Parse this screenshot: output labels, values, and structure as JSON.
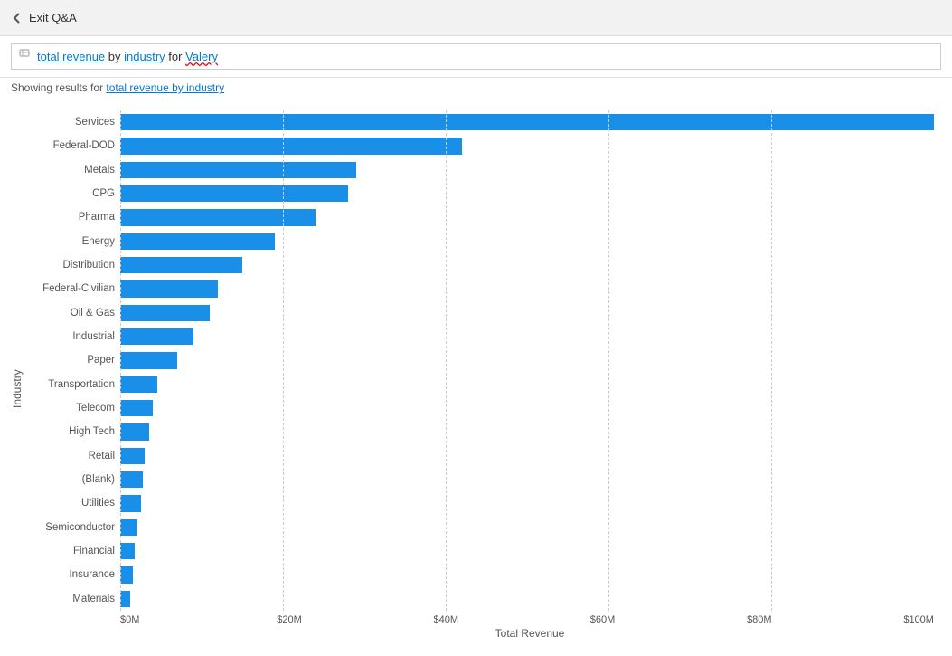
{
  "header": {
    "back_label": "Exit Q&A"
  },
  "search": {
    "query_parts": [
      {
        "text": "total revenue",
        "style": "underline-blue"
      },
      {
        "text": " by ",
        "style": "plain"
      },
      {
        "text": "industry",
        "style": "underline-blue"
      },
      {
        "text": " for ",
        "style": "plain"
      },
      {
        "text": "Valery",
        "style": "underline-red"
      }
    ]
  },
  "results_info": "Showing results for ",
  "results_link": "total revenue by industry",
  "y_axis_label": "Industry",
  "x_axis_label": "Total Revenue",
  "x_ticks": [
    "$0M",
    "$20M",
    "$40M",
    "$60M",
    "$80M",
    "$100M"
  ],
  "bars": [
    {
      "label": "Services",
      "value": 100
    },
    {
      "label": "Federal-DOD",
      "value": 42
    },
    {
      "label": "Metals",
      "value": 29
    },
    {
      "label": "CPG",
      "value": 28
    },
    {
      "label": "Pharma",
      "value": 24
    },
    {
      "label": "Energy",
      "value": 19
    },
    {
      "label": "Distribution",
      "value": 15
    },
    {
      "label": "Federal-Civilian",
      "value": 12
    },
    {
      "label": "Oil & Gas",
      "value": 11
    },
    {
      "label": "Industrial",
      "value": 9
    },
    {
      "label": "Paper",
      "value": 7
    },
    {
      "label": "Transportation",
      "value": 4.5
    },
    {
      "label": "Telecom",
      "value": 4
    },
    {
      "label": "High Tech",
      "value": 3.5
    },
    {
      "label": "Retail",
      "value": 3
    },
    {
      "label": "(Blank)",
      "value": 2.8
    },
    {
      "label": "Utilities",
      "value": 2.5
    },
    {
      "label": "Semiconductor",
      "value": 2
    },
    {
      "label": "Financial",
      "value": 1.8
    },
    {
      "label": "Insurance",
      "value": 1.5
    },
    {
      "label": "Materials",
      "value": 1.2
    }
  ],
  "colors": {
    "bar": "#1a8fe8",
    "grid": "#cccccc"
  }
}
